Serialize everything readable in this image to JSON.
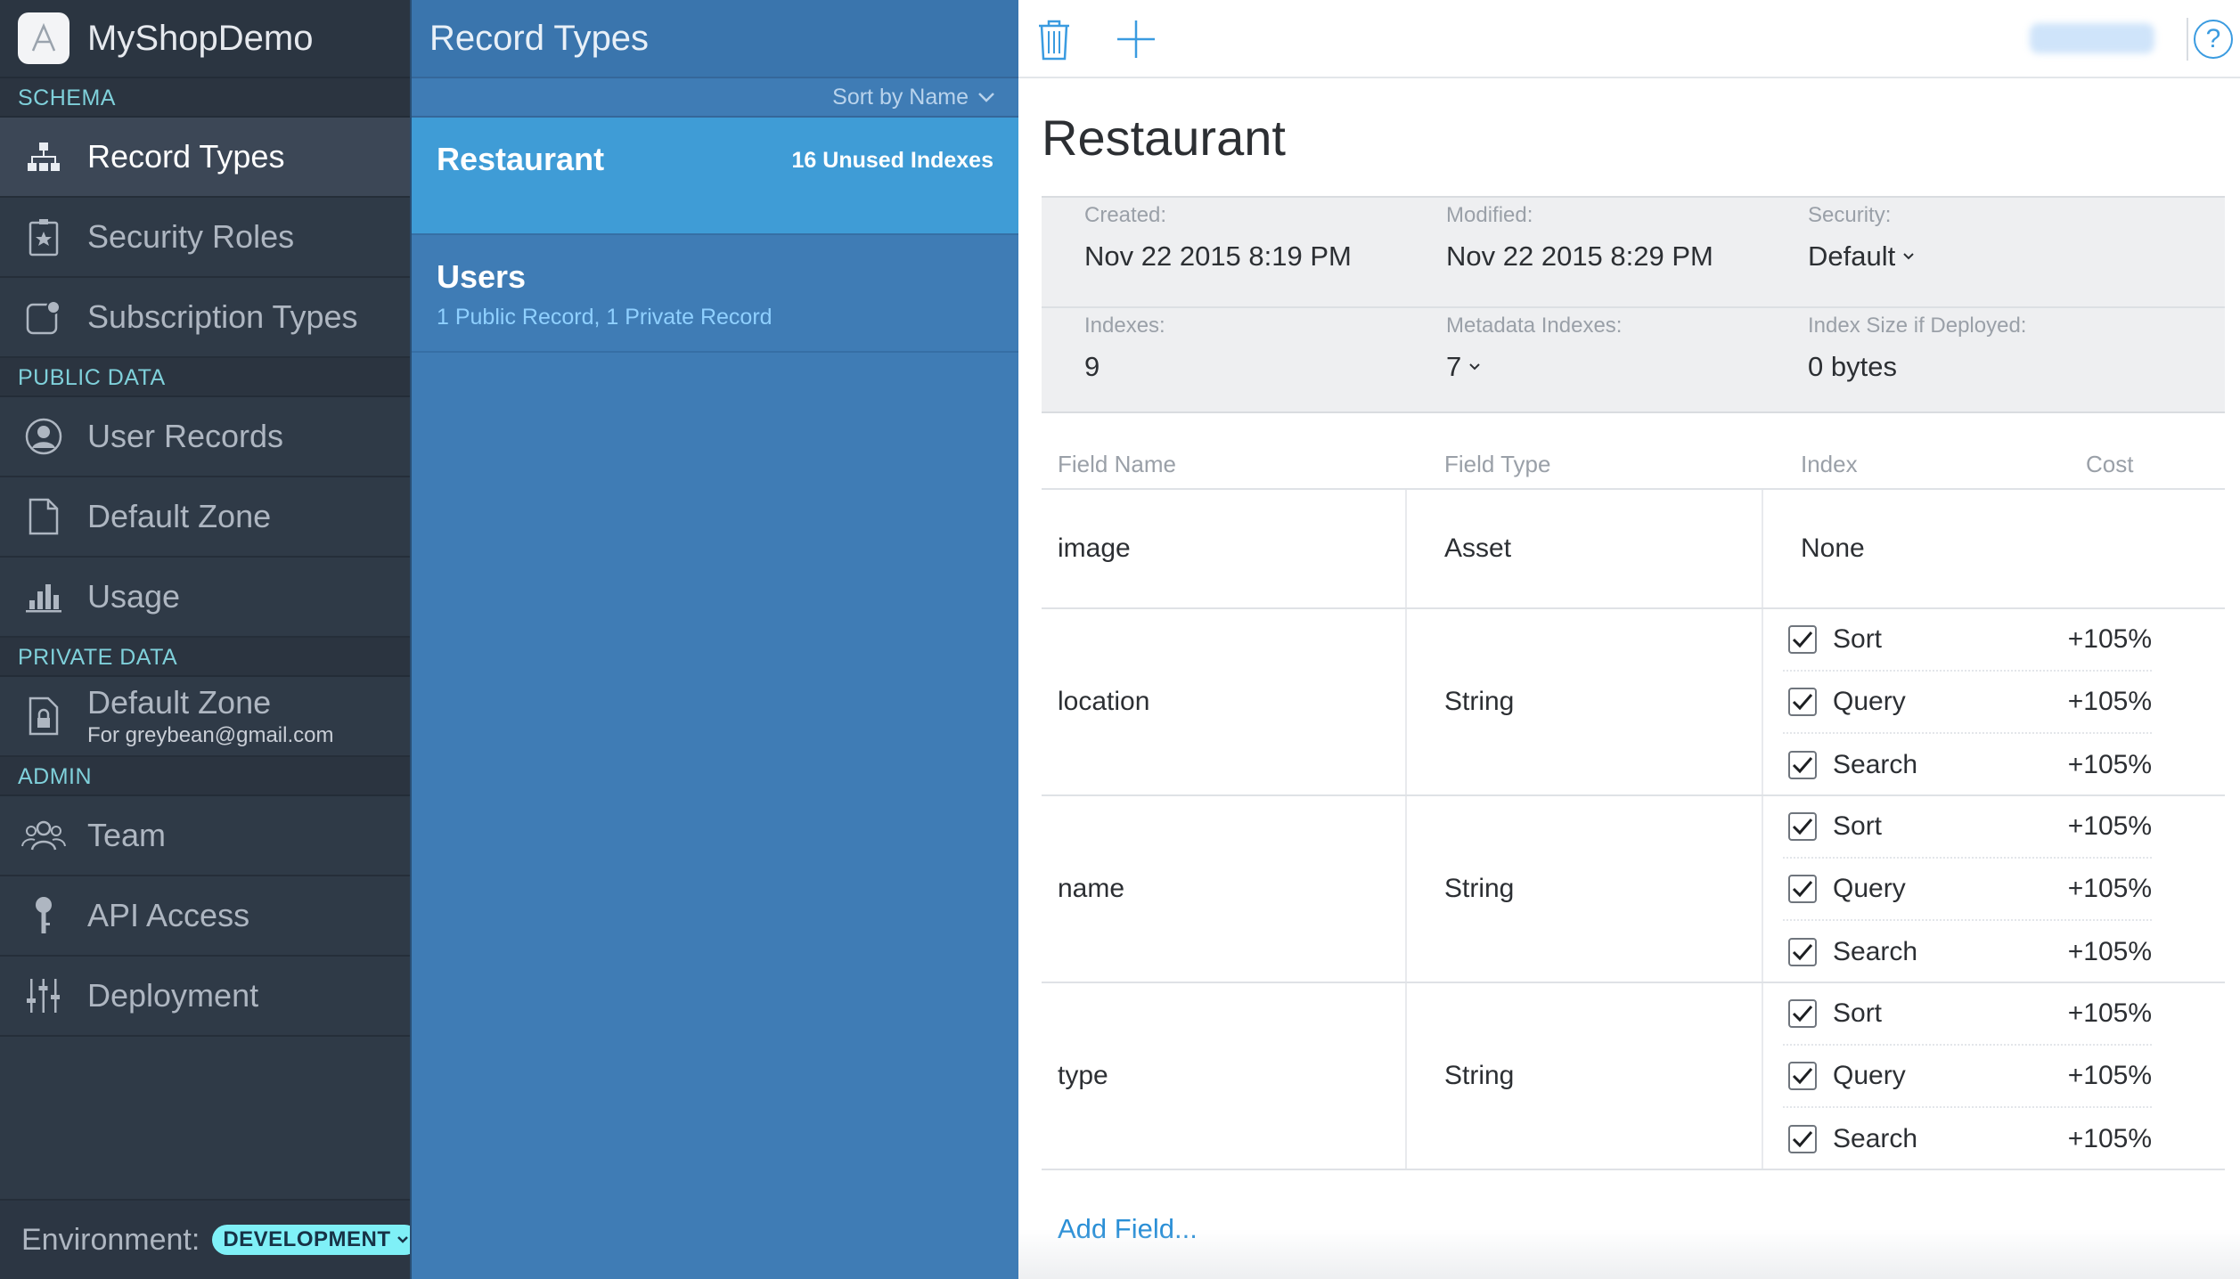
{
  "app": {
    "name": "MyShopDemo"
  },
  "sidebar": {
    "sections": [
      {
        "label": "SCHEMA",
        "items": [
          {
            "label": "Record Types",
            "icon": "hierarchy-icon",
            "active": true
          },
          {
            "label": "Security Roles",
            "icon": "badge-star-icon"
          },
          {
            "label": "Subscription Types",
            "icon": "subscription-icon"
          }
        ]
      },
      {
        "label": "PUBLIC DATA",
        "items": [
          {
            "label": "User Records",
            "icon": "user-circle-icon"
          },
          {
            "label": "Default Zone",
            "icon": "document-icon"
          },
          {
            "label": "Usage",
            "icon": "bar-chart-icon"
          }
        ]
      },
      {
        "label": "PRIVATE DATA",
        "items": [
          {
            "label": "Default Zone",
            "sub": "For greybean@gmail.com",
            "icon": "lock-document-icon"
          }
        ]
      },
      {
        "label": "ADMIN",
        "items": [
          {
            "label": "Team",
            "icon": "team-icon"
          },
          {
            "label": "API Access",
            "icon": "key-icon"
          },
          {
            "label": "Deployment",
            "icon": "sliders-icon"
          }
        ]
      }
    ],
    "environment": {
      "label": "Environment:",
      "value": "DEVELOPMENT"
    }
  },
  "list": {
    "title": "Record Types",
    "sort_label": "Sort by Name",
    "records": [
      {
        "name": "Restaurant",
        "badge": "16 Unused Indexes",
        "selected": true
      },
      {
        "name": "Users",
        "sub": "1 Public Record, 1 Private Record"
      }
    ]
  },
  "detail": {
    "title": "Restaurant",
    "meta": {
      "created_label": "Created:",
      "created": "Nov 22 2015 8:19 PM",
      "modified_label": "Modified:",
      "modified": "Nov 22 2015 8:29 PM",
      "security_label": "Security:",
      "security": "Default",
      "indexes_label": "Indexes:",
      "indexes": "9",
      "metadata_label": "Metadata Indexes:",
      "metadata": "7",
      "size_label": "Index Size if Deployed:",
      "size": "0 bytes"
    },
    "columns": {
      "field_name": "Field Name",
      "field_type": "Field Type",
      "index": "Index",
      "cost": "Cost"
    },
    "fields": [
      {
        "name": "image",
        "type": "Asset",
        "index_none": "None",
        "indexes": []
      },
      {
        "name": "location",
        "type": "String",
        "indexes": [
          {
            "name": "Sort",
            "cost": "+105%",
            "checked": true
          },
          {
            "name": "Query",
            "cost": "+105%",
            "checked": true
          },
          {
            "name": "Search",
            "cost": "+105%",
            "checked": true
          }
        ]
      },
      {
        "name": "name",
        "type": "String",
        "indexes": [
          {
            "name": "Sort",
            "cost": "+105%",
            "checked": true
          },
          {
            "name": "Query",
            "cost": "+105%",
            "checked": true
          },
          {
            "name": "Search",
            "cost": "+105%",
            "checked": true
          }
        ]
      },
      {
        "name": "type",
        "type": "String",
        "indexes": [
          {
            "name": "Sort",
            "cost": "+105%",
            "checked": true
          },
          {
            "name": "Query",
            "cost": "+105%",
            "checked": true
          },
          {
            "name": "Search",
            "cost": "+105%",
            "checked": true
          }
        ]
      }
    ],
    "add_field": "Add Field..."
  },
  "colors": {
    "sidebar_bg": "#2f3a47",
    "list_bg": "#3f7cb5",
    "selected_bg": "#3f9cd6",
    "accent": "#2a8fd6",
    "env_badge": "#7ff0f7"
  }
}
